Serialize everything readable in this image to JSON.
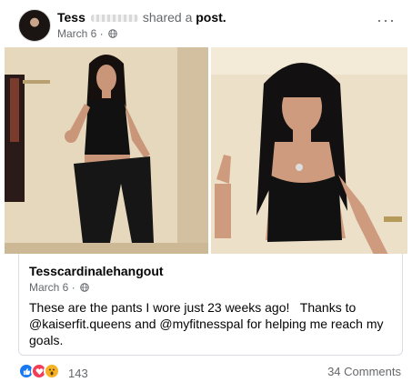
{
  "post": {
    "author": "Tess",
    "action_text": "shared a",
    "action_object": "post.",
    "time": "March 6 ·",
    "more_label": "···"
  },
  "shared": {
    "page_name": "Tesscardinalehangout",
    "time": "March 6 ·",
    "caption": "These are the pants I wore just 23 weeks ago!   Thanks to @kaiserfit.queens and @myfitnesspal for helping me reach my goals."
  },
  "footer": {
    "reaction_count": "143",
    "comments": "34 Comments"
  },
  "colors": {
    "like": "#1877f2",
    "love": "#f33e58",
    "wow": "#f7b125",
    "secondary_text": "#65676b"
  }
}
